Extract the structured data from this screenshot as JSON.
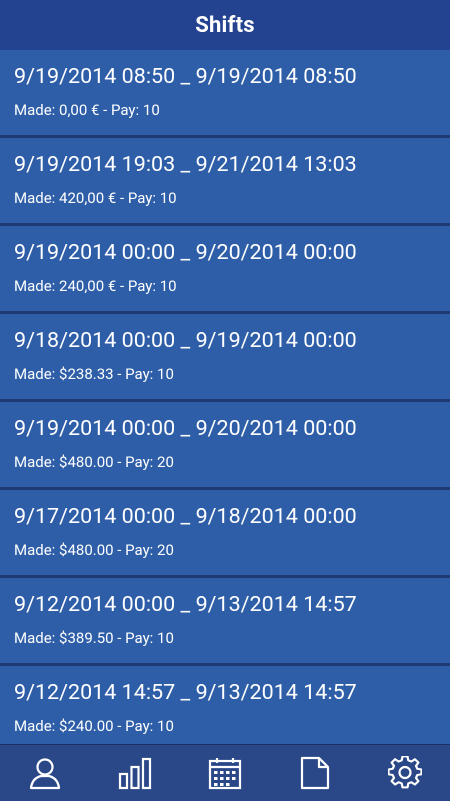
{
  "header": {
    "title": "Shifts"
  },
  "shifts": [
    {
      "range": "9/19/2014 08:50 _ 9/19/2014 08:50",
      "made": "Made: 0,00 € - Pay: 10"
    },
    {
      "range": "9/19/2014 19:03 _ 9/21/2014 13:03",
      "made": "Made: 420,00 € - Pay: 10"
    },
    {
      "range": "9/19/2014 00:00 _ 9/20/2014 00:00",
      "made": "Made: 240,00 € - Pay: 10"
    },
    {
      "range": "9/18/2014 00:00 _ 9/19/2014 00:00",
      "made": "Made: $238.33 - Pay: 10"
    },
    {
      "range": "9/19/2014 00:00 _ 9/20/2014 00:00",
      "made": "Made: $480.00 - Pay: 20"
    },
    {
      "range": "9/17/2014 00:00 _ 9/18/2014 00:00",
      "made": "Made: $480.00 - Pay: 20"
    },
    {
      "range": "9/12/2014 00:00 _ 9/13/2014 14:57",
      "made": "Made: $389.50 - Pay: 10"
    },
    {
      "range": "9/12/2014 14:57 _ 9/13/2014 14:57",
      "made": "Made: $240.00 - Pay: 10"
    }
  ],
  "nav": [
    {
      "icon": "user-icon"
    },
    {
      "icon": "bar-chart-icon"
    },
    {
      "icon": "calendar-icon"
    },
    {
      "icon": "document-icon"
    },
    {
      "icon": "gear-icon"
    }
  ],
  "colors": {
    "header_bg": "#23428f",
    "row_bg": "#2e5ea8",
    "divider": "#1d3a72",
    "nav_bg": "#2a4888",
    "text": "#ffffff"
  }
}
